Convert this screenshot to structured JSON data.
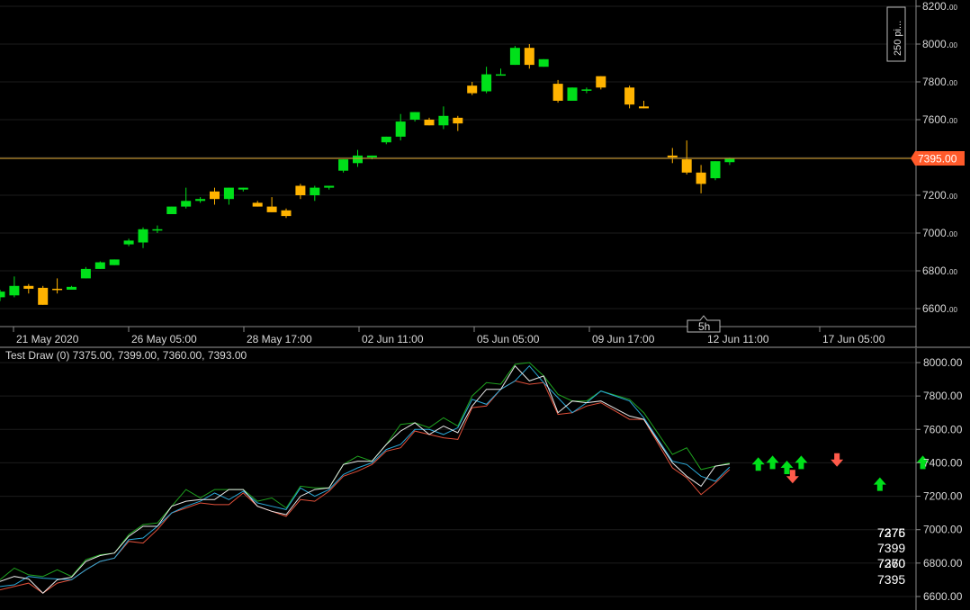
{
  "colors": {
    "background": "#000000",
    "bull": "#00e01a",
    "bear": "#ffb300",
    "price_line": "#c8962e",
    "price_badge": "#ff5a2a",
    "up_arrow": "#00e01a",
    "down_arrow": "#ff5a4a",
    "grid": "#1c1c1c",
    "line_high": "#1fa31f",
    "line_low": "#e2503a",
    "line_open": "#2aa8d8",
    "line_close": "#e8e8e8"
  },
  "chart_data": [
    {
      "type": "candlestick",
      "ylim": [
        6500,
        8250
      ],
      "y_ticks": [
        {
          "value": 8200,
          "major": "8200.",
          "minor": "00"
        },
        {
          "value": 8000,
          "major": "8000.",
          "minor": "00"
        },
        {
          "value": 7800,
          "major": "7800.",
          "minor": "00"
        },
        {
          "value": 7600,
          "major": "7600.",
          "minor": "00"
        },
        {
          "value": 7400,
          "major": "7400.",
          "minor": "00"
        },
        {
          "value": 7200,
          "major": "7200.",
          "minor": "00"
        },
        {
          "value": 7000,
          "major": "7000.",
          "minor": "00"
        },
        {
          "value": 6800,
          "major": "6800.",
          "minor": "00"
        },
        {
          "value": 6600,
          "major": "6600.",
          "minor": "00"
        }
      ],
      "x_ticks": [
        "21 May 2020",
        "26 May 05:00",
        "28 May 17:00",
        "02 Jun 11:00",
        "05 Jun 05:00",
        "09 Jun 17:00",
        "12 Jun 11:00",
        "17 Jun 05:00"
      ],
      "timeframe_label": "5h",
      "scale_label": "250 pi...",
      "current_price": 7395,
      "current_price_label": "7395.00",
      "candles": [
        {
          "o": 6660,
          "h": 6700,
          "l": 6640,
          "c": 6690
        },
        {
          "o": 6670,
          "h": 6770,
          "l": 6660,
          "c": 6720
        },
        {
          "o": 6720,
          "h": 6730,
          "l": 6680,
          "c": 6705
        },
        {
          "o": 6710,
          "h": 6720,
          "l": 6620,
          "c": 6620
        },
        {
          "o": 6705,
          "h": 6760,
          "l": 6680,
          "c": 6700
        },
        {
          "o": 6700,
          "h": 6720,
          "l": 6700,
          "c": 6715
        },
        {
          "o": 6760,
          "h": 6820,
          "l": 6760,
          "c": 6810
        },
        {
          "o": 6810,
          "h": 6850,
          "l": 6810,
          "c": 6845
        },
        {
          "o": 6830,
          "h": 6860,
          "l": 6830,
          "c": 6860
        },
        {
          "o": 6940,
          "h": 6970,
          "l": 6930,
          "c": 6960
        },
        {
          "o": 6950,
          "h": 7030,
          "l": 6920,
          "c": 7020
        },
        {
          "o": 7020,
          "h": 7040,
          "l": 7000,
          "c": 7020
        },
        {
          "o": 7100,
          "h": 7140,
          "l": 7100,
          "c": 7140
        },
        {
          "o": 7140,
          "h": 7240,
          "l": 7130,
          "c": 7170
        },
        {
          "o": 7170,
          "h": 7190,
          "l": 7160,
          "c": 7180
        },
        {
          "o": 7220,
          "h": 7240,
          "l": 7150,
          "c": 7180
        },
        {
          "o": 7180,
          "h": 7240,
          "l": 7150,
          "c": 7240
        },
        {
          "o": 7230,
          "h": 7240,
          "l": 7220,
          "c": 7240
        },
        {
          "o": 7160,
          "h": 7170,
          "l": 7140,
          "c": 7140
        },
        {
          "o": 7140,
          "h": 7190,
          "l": 7110,
          "c": 7110
        },
        {
          "o": 7120,
          "h": 7130,
          "l": 7080,
          "c": 7090
        },
        {
          "o": 7250,
          "h": 7260,
          "l": 7180,
          "c": 7200
        },
        {
          "o": 7200,
          "h": 7250,
          "l": 7170,
          "c": 7240
        },
        {
          "o": 7240,
          "h": 7250,
          "l": 7230,
          "c": 7250
        },
        {
          "o": 7330,
          "h": 7390,
          "l": 7320,
          "c": 7390
        },
        {
          "o": 7370,
          "h": 7440,
          "l": 7350,
          "c": 7410
        },
        {
          "o": 7400,
          "h": 7410,
          "l": 7390,
          "c": 7410
        },
        {
          "o": 7480,
          "h": 7510,
          "l": 7470,
          "c": 7510
        },
        {
          "o": 7510,
          "h": 7630,
          "l": 7490,
          "c": 7590
        },
        {
          "o": 7600,
          "h": 7640,
          "l": 7590,
          "c": 7640
        },
        {
          "o": 7600,
          "h": 7610,
          "l": 7570,
          "c": 7570
        },
        {
          "o": 7570,
          "h": 7670,
          "l": 7550,
          "c": 7620
        },
        {
          "o": 7610,
          "h": 7620,
          "l": 7540,
          "c": 7580
        },
        {
          "o": 7780,
          "h": 7800,
          "l": 7730,
          "c": 7740
        },
        {
          "o": 7750,
          "h": 7880,
          "l": 7740,
          "c": 7840
        },
        {
          "o": 7840,
          "h": 7870,
          "l": 7840,
          "c": 7840
        },
        {
          "o": 7890,
          "h": 7990,
          "l": 7890,
          "c": 7980
        },
        {
          "o": 7980,
          "h": 8000,
          "l": 7870,
          "c": 7890
        },
        {
          "o": 7880,
          "h": 7920,
          "l": 7880,
          "c": 7920
        },
        {
          "o": 7790,
          "h": 7810,
          "l": 7690,
          "c": 7700
        },
        {
          "o": 7700,
          "h": 7770,
          "l": 7700,
          "c": 7770
        },
        {
          "o": 7760,
          "h": 7770,
          "l": 7740,
          "c": 7760
        },
        {
          "o": 7830,
          "h": 7830,
          "l": 7760,
          "c": 7770
        },
        {
          "o": 7770,
          "h": 7780,
          "l": 7660,
          "c": 7680
        },
        {
          "o": 7670,
          "h": 7700,
          "l": 7660,
          "c": 7660
        },
        {
          "o": 7410,
          "h": 7450,
          "l": 7370,
          "c": 7400
        },
        {
          "o": 7390,
          "h": 7490,
          "l": 7310,
          "c": 7320
        },
        {
          "o": 7320,
          "h": 7360,
          "l": 7210,
          "c": 7260
        },
        {
          "o": 7290,
          "h": 7380,
          "l": 7280,
          "c": 7380
        },
        {
          "o": 7375,
          "h": 7399,
          "l": 7360,
          "c": 7393
        }
      ],
      "slots": [
        0,
        1,
        2,
        3,
        4,
        5,
        6,
        7,
        8,
        9,
        10,
        11,
        12,
        13,
        14,
        15,
        16,
        17,
        18,
        19,
        20,
        21,
        22,
        23,
        24,
        25,
        26,
        27,
        28,
        29,
        30,
        31,
        32,
        33,
        34,
        35,
        36,
        37,
        38,
        39,
        40,
        41,
        42,
        44,
        45,
        47,
        48,
        49,
        50,
        51
      ]
    },
    {
      "type": "line",
      "title": "Test Draw (0) 7375.00, 7399.00, 7360.00, 7393.00",
      "ylim": [
        6560,
        8060
      ],
      "y_ticks": [
        {
          "value": 8000,
          "label": "8000.00"
        },
        {
          "value": 7800,
          "label": "7800.00"
        },
        {
          "value": 7600,
          "label": "7600.00"
        },
        {
          "value": 7400,
          "label": "7400.00"
        },
        {
          "value": 7200,
          "label": "7200.00"
        },
        {
          "value": 7000,
          "label": "7000.00"
        },
        {
          "value": 6800,
          "label": "6800.00"
        },
        {
          "value": 6600,
          "label": "6600.00"
        }
      ],
      "series_source": "candles from the price chart (open, high, low, close)",
      "arrows": [
        {
          "slot": 53,
          "dir": "up",
          "value": 7390
        },
        {
          "slot": 54,
          "dir": "up",
          "value": 7400
        },
        {
          "slot": 55,
          "dir": "up",
          "value": 7370
        },
        {
          "slot": 55.4,
          "dir": "down",
          "value": 7320
        },
        {
          "slot": 56,
          "dir": "up",
          "value": 7400
        },
        {
          "slot": 58.5,
          "dir": "down",
          "value": 7420
        },
        {
          "slot": 61.5,
          "dir": "up",
          "value": 7270
        },
        {
          "slot": 64.5,
          "dir": "up",
          "value": 7400
        }
      ],
      "stacked_values": [
        {
          "text": "7375",
          "top": 584
        },
        {
          "text": "7399",
          "top": 601
        },
        {
          "text": "7360",
          "top": 618
        },
        {
          "text": "7395",
          "top": 636
        }
      ],
      "overlay_values": [
        {
          "text": "7276",
          "top": 584
        },
        {
          "text": "7270",
          "top": 618
        }
      ]
    }
  ]
}
